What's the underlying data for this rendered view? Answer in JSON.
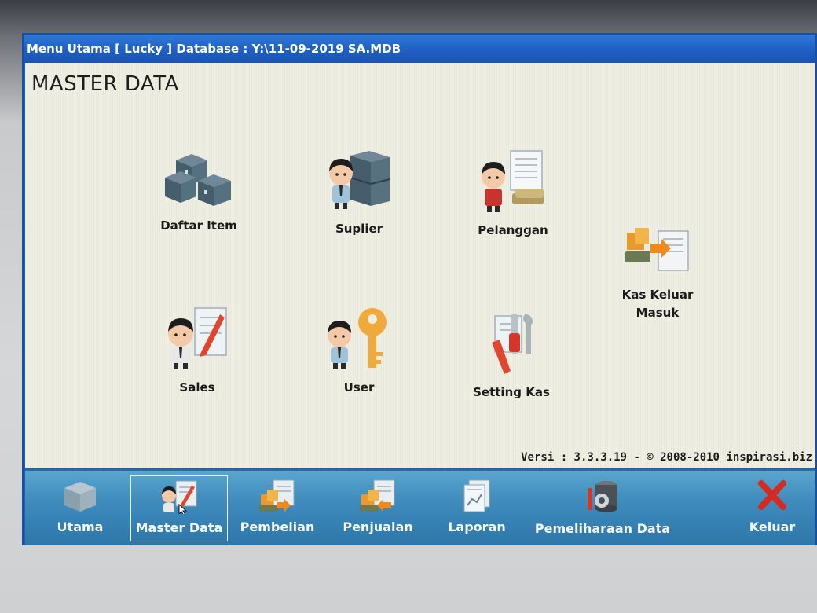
{
  "window": {
    "title": "Menu Utama [ Lucky ] Database : Y:\\11-09-2019 SA.MDB"
  },
  "main": {
    "section_title": "MASTER DATA",
    "items": [
      {
        "label": "Daftar Item",
        "icon": "boxes-icon"
      },
      {
        "label": "Suplier",
        "icon": "supplier-icon"
      },
      {
        "label": "Pelanggan",
        "icon": "customer-icon"
      },
      {
        "label": "Kas Keluar Masuk",
        "icon": "cash-flow-icon"
      },
      {
        "label": "Sales",
        "icon": "sales-icon"
      },
      {
        "label": "User",
        "icon": "user-key-icon"
      },
      {
        "label": "Setting Kas",
        "icon": "settings-tools-icon"
      }
    ],
    "version": "Versi : 3.3.3.19 - © 2008-2010 inspirasi.biz"
  },
  "toolbar": {
    "items": [
      {
        "label": "Utama",
        "icon": "home-box-icon",
        "active": false
      },
      {
        "label": "Master Data",
        "icon": "master-data-icon",
        "active": true
      },
      {
        "label": "Pembelian",
        "icon": "purchase-icon",
        "active": false
      },
      {
        "label": "Penjualan",
        "icon": "sales-transaction-icon",
        "active": false
      },
      {
        "label": "Laporan",
        "icon": "report-icon",
        "active": false
      },
      {
        "label": "Pemeliharaan Data",
        "icon": "maintenance-icon",
        "active": false
      },
      {
        "label": "Keluar",
        "icon": "exit-x-icon",
        "active": false
      }
    ]
  },
  "colors": {
    "titlebar": "#1f5fc4",
    "content_bg": "#efeee2",
    "toolbar": "#3f8cbd",
    "exit_red": "#d62a1e"
  }
}
